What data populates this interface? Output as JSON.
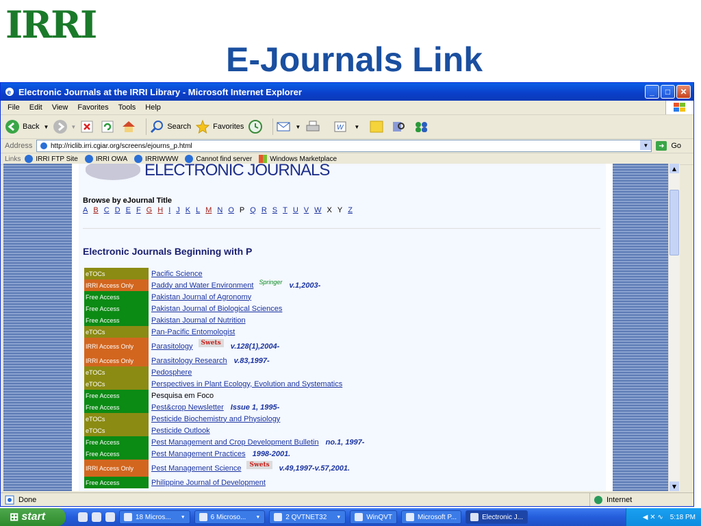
{
  "slide": {
    "logo": "IRRI",
    "title": "E-Journals Link"
  },
  "window": {
    "title": "Electronic Journals at the IRRI Library - Microsoft Internet Explorer"
  },
  "menu": [
    "File",
    "Edit",
    "View",
    "Favorites",
    "Tools",
    "Help"
  ],
  "toolbar": {
    "back": "Back",
    "search": "Search",
    "favorites": "Favorites"
  },
  "address": {
    "label": "Address",
    "url": "http://riclib.irri.cgiar.org/screens/ejourns_p.html",
    "go": "Go"
  },
  "links": {
    "label": "Links",
    "items": [
      "IRRI FTP Site",
      "IRRI OWA",
      "IRRIWWW",
      "Cannot find server",
      "Windows Marketplace"
    ]
  },
  "page": {
    "banner": "ELECTRONIC JOURNALS",
    "browse_title": "Browse by eJournal Title",
    "letters": [
      "A",
      "B",
      "C",
      "D",
      "E",
      "F",
      "G",
      "H",
      "I",
      "J",
      "K",
      "L",
      "M",
      "N",
      "O",
      "P",
      "Q",
      "R",
      "S",
      "T",
      "U",
      "V",
      "W",
      "X",
      "Y",
      "Z"
    ],
    "section_title": "Electronic Journals Beginning with P",
    "journals": [
      {
        "access": "eTOCs",
        "title": "Pacific Science",
        "coverage": ""
      },
      {
        "access": "IRRI Access Only",
        "title": "Paddy and Water Environment",
        "publisher": "Springer",
        "coverage": "v.1,2003-"
      },
      {
        "access": "Free Access",
        "title": "Pakistan Journal of Agronomy",
        "coverage": ""
      },
      {
        "access": "Free Access",
        "title": "Pakistan Journal of Biological Sciences",
        "coverage": ""
      },
      {
        "access": "Free Access",
        "title": "Pakistan Journal of Nutrition",
        "coverage": ""
      },
      {
        "access": "eTOCs",
        "title": "Pan-Pacific Entomologist",
        "coverage": ""
      },
      {
        "access": "IRRI Access Only",
        "title": "Parasitology",
        "publisher": "Swets",
        "coverage": "v.128(1),2004-"
      },
      {
        "access": "IRRI Access Only",
        "title": "Parasitology Research",
        "coverage": "v.83,1997-"
      },
      {
        "access": "eTOCs",
        "title": "Pedosphere",
        "coverage": ""
      },
      {
        "access": "eTOCs",
        "title": "Perspectives in Plant Ecology, Evolution and Systematics",
        "coverage": ""
      },
      {
        "access": "Free Access",
        "title": "Pesquisa em Foco",
        "coverage": ""
      },
      {
        "access": "Free Access",
        "title": "Pest&crop Newsletter",
        "coverage": "Issue 1, 1995-"
      },
      {
        "access": "eTOCs",
        "title": "Pesticide Biochemistry and Physiology",
        "coverage": ""
      },
      {
        "access": "eTOCs",
        "title": "Pesticide Outlook",
        "coverage": ""
      },
      {
        "access": "Free Access",
        "title": "Pest Management and Crop Development Bulletin",
        "coverage": "no.1, 1997-"
      },
      {
        "access": "Free Access",
        "title": "Pest Management Practices",
        "coverage": "1998-2001."
      },
      {
        "access": "IRRI Access Only",
        "title": "Pest Management Science",
        "publisher": "Swets",
        "coverage": "v.49,1997-v.57,2001."
      },
      {
        "access": "Free Access",
        "title": "Philippine Journal of Development",
        "coverage": ""
      }
    ]
  },
  "status": {
    "text": "Done",
    "zone": "Internet"
  },
  "taskbar": {
    "start": "start",
    "tasks": [
      "18 Micros...",
      "6 Microso...",
      "2 QVTNET32",
      "WinQVT",
      "Microsoft P...",
      "Electronic J..."
    ],
    "clock": "5:18 PM"
  },
  "colors": {
    "etocs": "#8b8b13",
    "irri": "#d2661f",
    "free": "#0b8a14",
    "title_blue": "#1a4fa0"
  }
}
